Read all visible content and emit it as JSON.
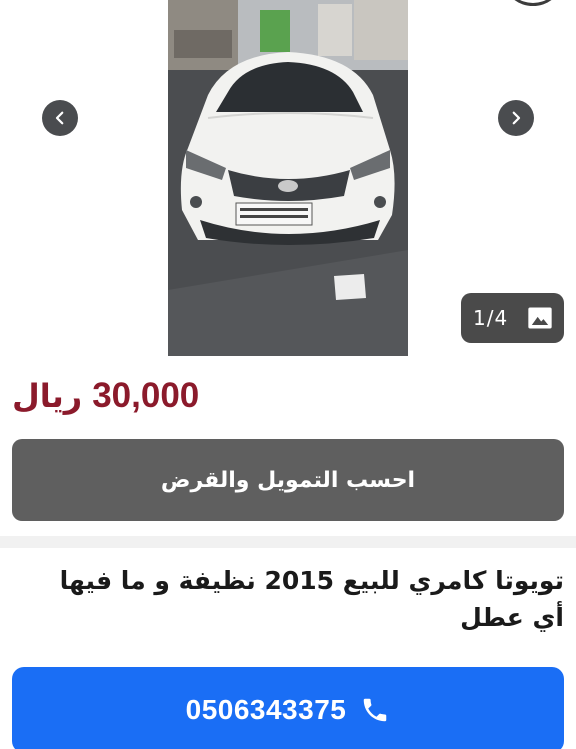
{
  "gallery": {
    "photo_alt": "car-photo",
    "counter": "1/4",
    "counter_icon": "image-icon",
    "prev_icon": "chevron-left-icon",
    "next_icon": "chevron-right-icon"
  },
  "listing": {
    "price_amount": "30,000",
    "price_currency": "ريال",
    "finance_label": "احسب التمويل والقرض",
    "title": "تويوتا كامري للبيع 2015 نظيفة و ما فيها أي عطل"
  },
  "contact": {
    "phone": "0506343375",
    "phone_icon": "phone-icon"
  },
  "colors": {
    "price": "#8b1a2b",
    "finance_button": "#5f5f5f",
    "call_button": "#1a6ef5"
  }
}
